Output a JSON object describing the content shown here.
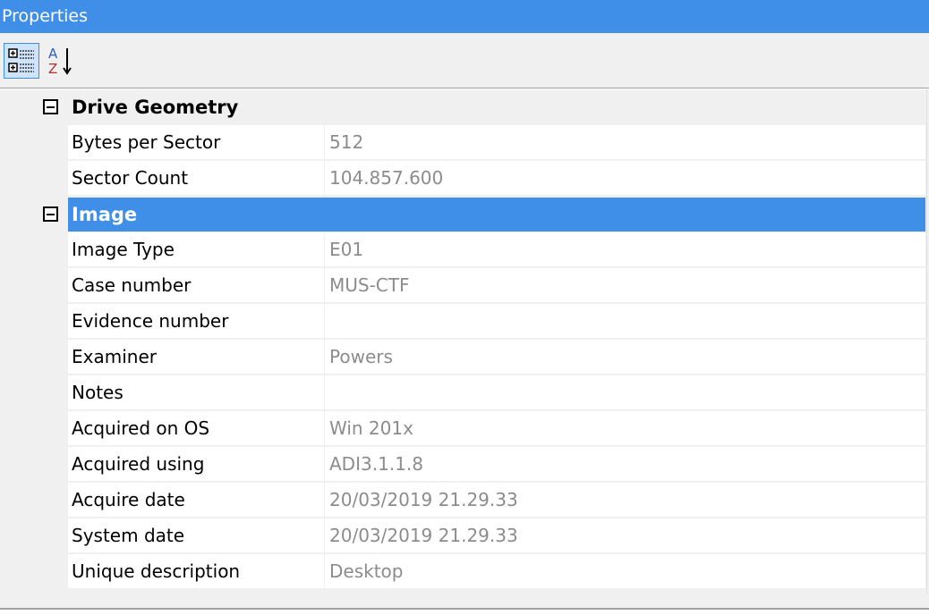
{
  "window": {
    "title": "Properties"
  },
  "toolbar": {
    "categorized_icon": "categorized-view-icon",
    "alphabetical_icon": "sort-alphabetical-icon",
    "alpha_top": "A",
    "alpha_bottom": "Z",
    "arrow": "↓"
  },
  "colors": {
    "accent": "#3f8fe8",
    "value_text": "#8c8c8c"
  },
  "categories": [
    {
      "name": "Drive Geometry",
      "expanded": true,
      "selected": false,
      "properties": [
        {
          "name": "Bytes per Sector",
          "value": "512"
        },
        {
          "name": "Sector Count",
          "value": "104.857.600"
        }
      ]
    },
    {
      "name": "Image",
      "expanded": true,
      "selected": true,
      "properties": [
        {
          "name": "Image Type",
          "value": "E01"
        },
        {
          "name": "Case number",
          "value": "MUS-CTF"
        },
        {
          "name": "Evidence number",
          "value": ""
        },
        {
          "name": "Examiner",
          "value": "Powers"
        },
        {
          "name": "Notes",
          "value": ""
        },
        {
          "name": "Acquired on OS",
          "value": "Win 201x"
        },
        {
          "name": "Acquired using",
          "value": "ADI3.1.1.8"
        },
        {
          "name": "Acquire date",
          "value": "20/03/2019 21.29.33"
        },
        {
          "name": "System date",
          "value": "20/03/2019 21.29.33"
        },
        {
          "name": "Unique description",
          "value": "Desktop"
        }
      ]
    }
  ]
}
